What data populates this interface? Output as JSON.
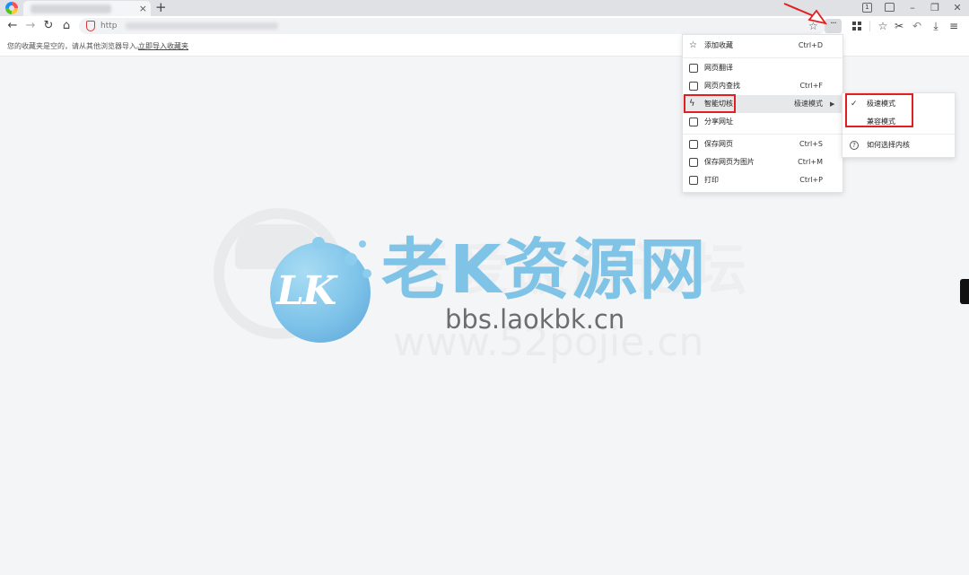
{
  "tabbar": {
    "tab_close": "×",
    "new_tab": "+",
    "tab_count": "1",
    "minimize": "–",
    "restore": "❐",
    "close": "✕"
  },
  "toolbar": {
    "back": "←",
    "forward": "→",
    "reload": "↻",
    "home": "⌂",
    "url_prefix": "http",
    "bookmark_star": "☆",
    "more": "···",
    "favorites": "☆",
    "screenshot": "✂",
    "undo": "↶",
    "download": "⤓",
    "menu": "≡"
  },
  "bookmarks": {
    "empty_message": "您的收藏夹是空的，请从其他浏览器导入。",
    "import_link": "立即导入收藏夹"
  },
  "watermark": {
    "logo_text": "LK",
    "brand": "老K资源网",
    "url": "bbs.laokbk.cn",
    "ghost_text": "吾爱破解论坛",
    "ghost_url": "www.52pojie.cn"
  },
  "menu": {
    "items": [
      {
        "label": "添加收藏",
        "shortcut": "Ctrl+D"
      },
      {
        "label": "网页翻译",
        "shortcut": ""
      },
      {
        "label": "网页内查找",
        "shortcut": "Ctrl+F"
      },
      {
        "label": "智能切核",
        "shortcut": "",
        "submenu_value": "极速模式"
      },
      {
        "label": "分享网址",
        "shortcut": ""
      },
      {
        "label": "保存网页",
        "shortcut": "Ctrl+S"
      },
      {
        "label": "保存网页为图片",
        "shortcut": "Ctrl+M"
      },
      {
        "label": "打印",
        "shortcut": "Ctrl+P"
      }
    ],
    "submenu_arrow": "▶"
  },
  "submenu": {
    "items": [
      {
        "label": "极速模式",
        "checked": true
      },
      {
        "label": "兼容模式",
        "checked": false
      }
    ],
    "help_label": "如何选择内核",
    "check_mark": "✓",
    "help_glyph": "?"
  },
  "colors": {
    "highlight_box": "#e02020",
    "arrow": "#e02020",
    "brand": "#7fc3e6"
  }
}
